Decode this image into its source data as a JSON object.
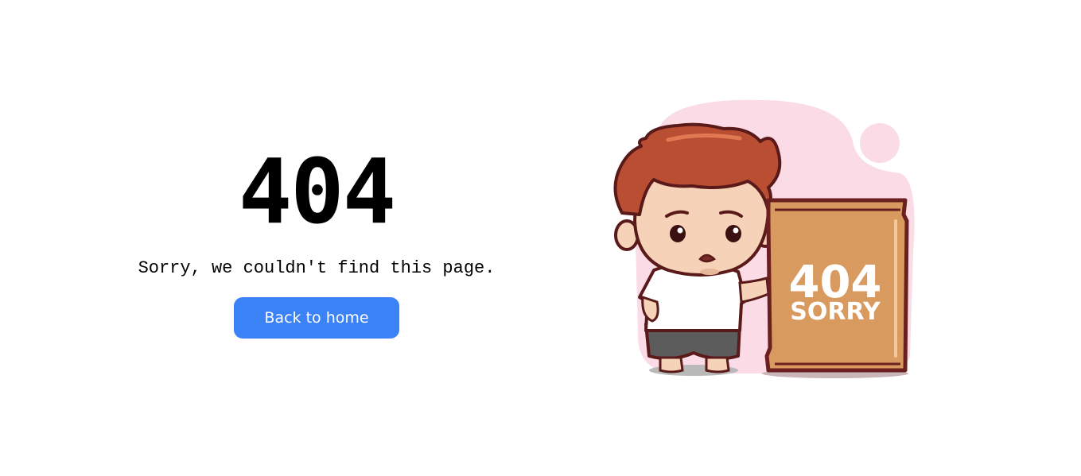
{
  "error": {
    "code": "404",
    "message": "Sorry, we couldn't find this page."
  },
  "actions": {
    "back_home_label": "Back to home"
  },
  "illustration": {
    "sign_line1": "404",
    "sign_line2": "SORRY"
  },
  "colors": {
    "button": "#3b82f6",
    "blob": "#fadbe6",
    "board": "#d99a5f",
    "outline": "#6b1f1f"
  }
}
